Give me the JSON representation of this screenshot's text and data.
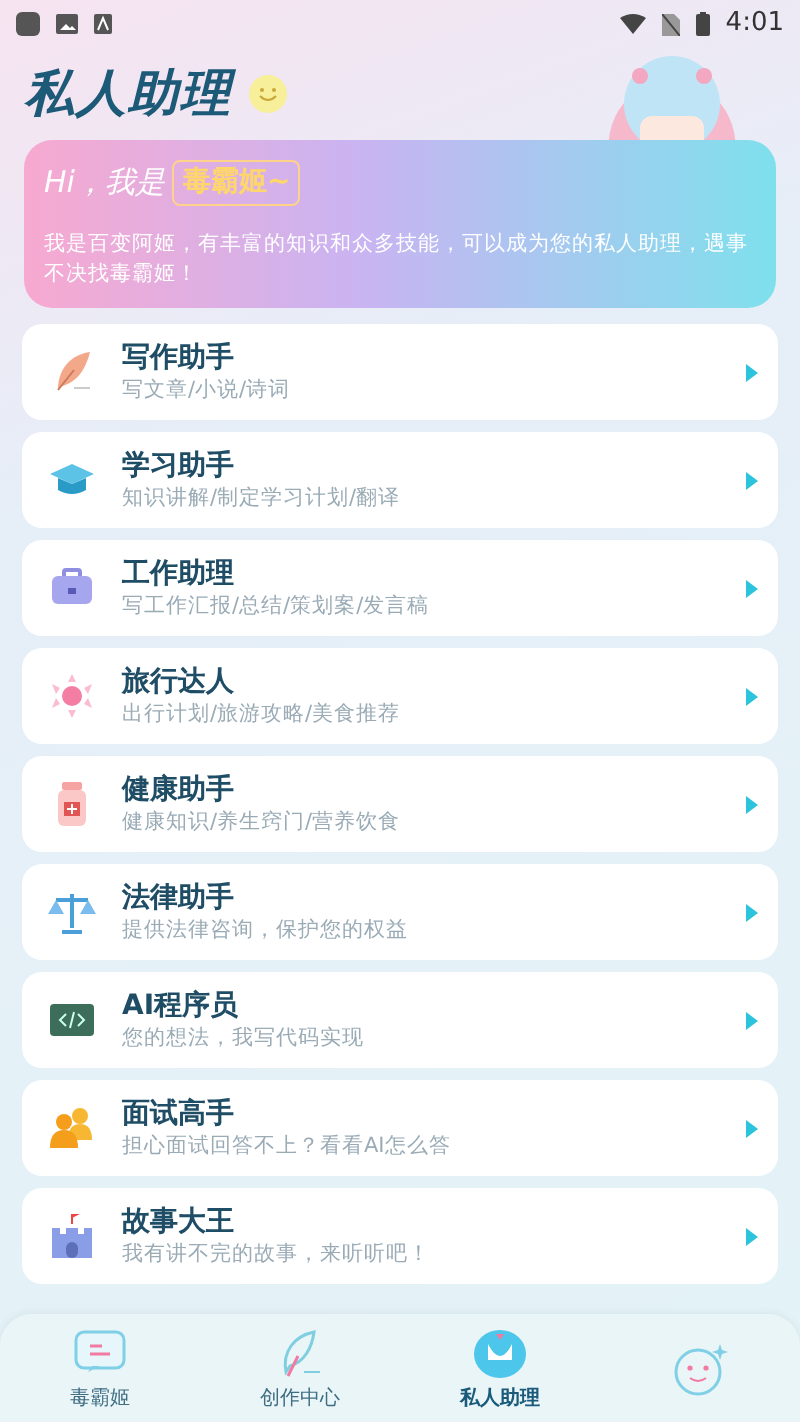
{
  "status_bar": {
    "time": "4:01"
  },
  "header": {
    "title": "私人助理"
  },
  "banner": {
    "greeting": "Hi，我是",
    "name": "毒霸姬~",
    "description": "我是百变阿姬，有丰富的知识和众多技能，可以成为您的私人助理，遇事不决找毒霸姬！"
  },
  "assistants": [
    {
      "kind": "quill",
      "title": "写作助手",
      "subtitle": "写文章/小说/诗词"
    },
    {
      "kind": "cap",
      "title": "学习助手",
      "subtitle": "知识讲解/制定学习计划/翻译"
    },
    {
      "kind": "briefcase",
      "title": "工作助理",
      "subtitle": "写工作汇报/总结/策划案/发言稿"
    },
    {
      "kind": "sun",
      "title": "旅行达人",
      "subtitle": "出行计划/旅游攻略/美食推荐"
    },
    {
      "kind": "medicine",
      "title": "健康助手",
      "subtitle": "健康知识/养生窍门/营养饮食"
    },
    {
      "kind": "scales",
      "title": "法律助手",
      "subtitle": "提供法律咨询，保护您的权益"
    },
    {
      "kind": "code",
      "title": "AI程序员",
      "subtitle": "您的想法，我写代码实现"
    },
    {
      "kind": "people",
      "title": "面试高手",
      "subtitle": "担心面试回答不上？看看AI怎么答"
    },
    {
      "kind": "castle",
      "title": "故事大王",
      "subtitle": "我有讲不完的故事，来听听吧！"
    }
  ],
  "bottom_nav": [
    {
      "kind": "chat",
      "label": "毒霸姬",
      "selected": false
    },
    {
      "kind": "feather",
      "label": "创作中心",
      "selected": false
    },
    {
      "kind": "assistant",
      "label": "私人助理",
      "selected": true
    },
    {
      "kind": "smiley",
      "selected": false
    }
  ]
}
